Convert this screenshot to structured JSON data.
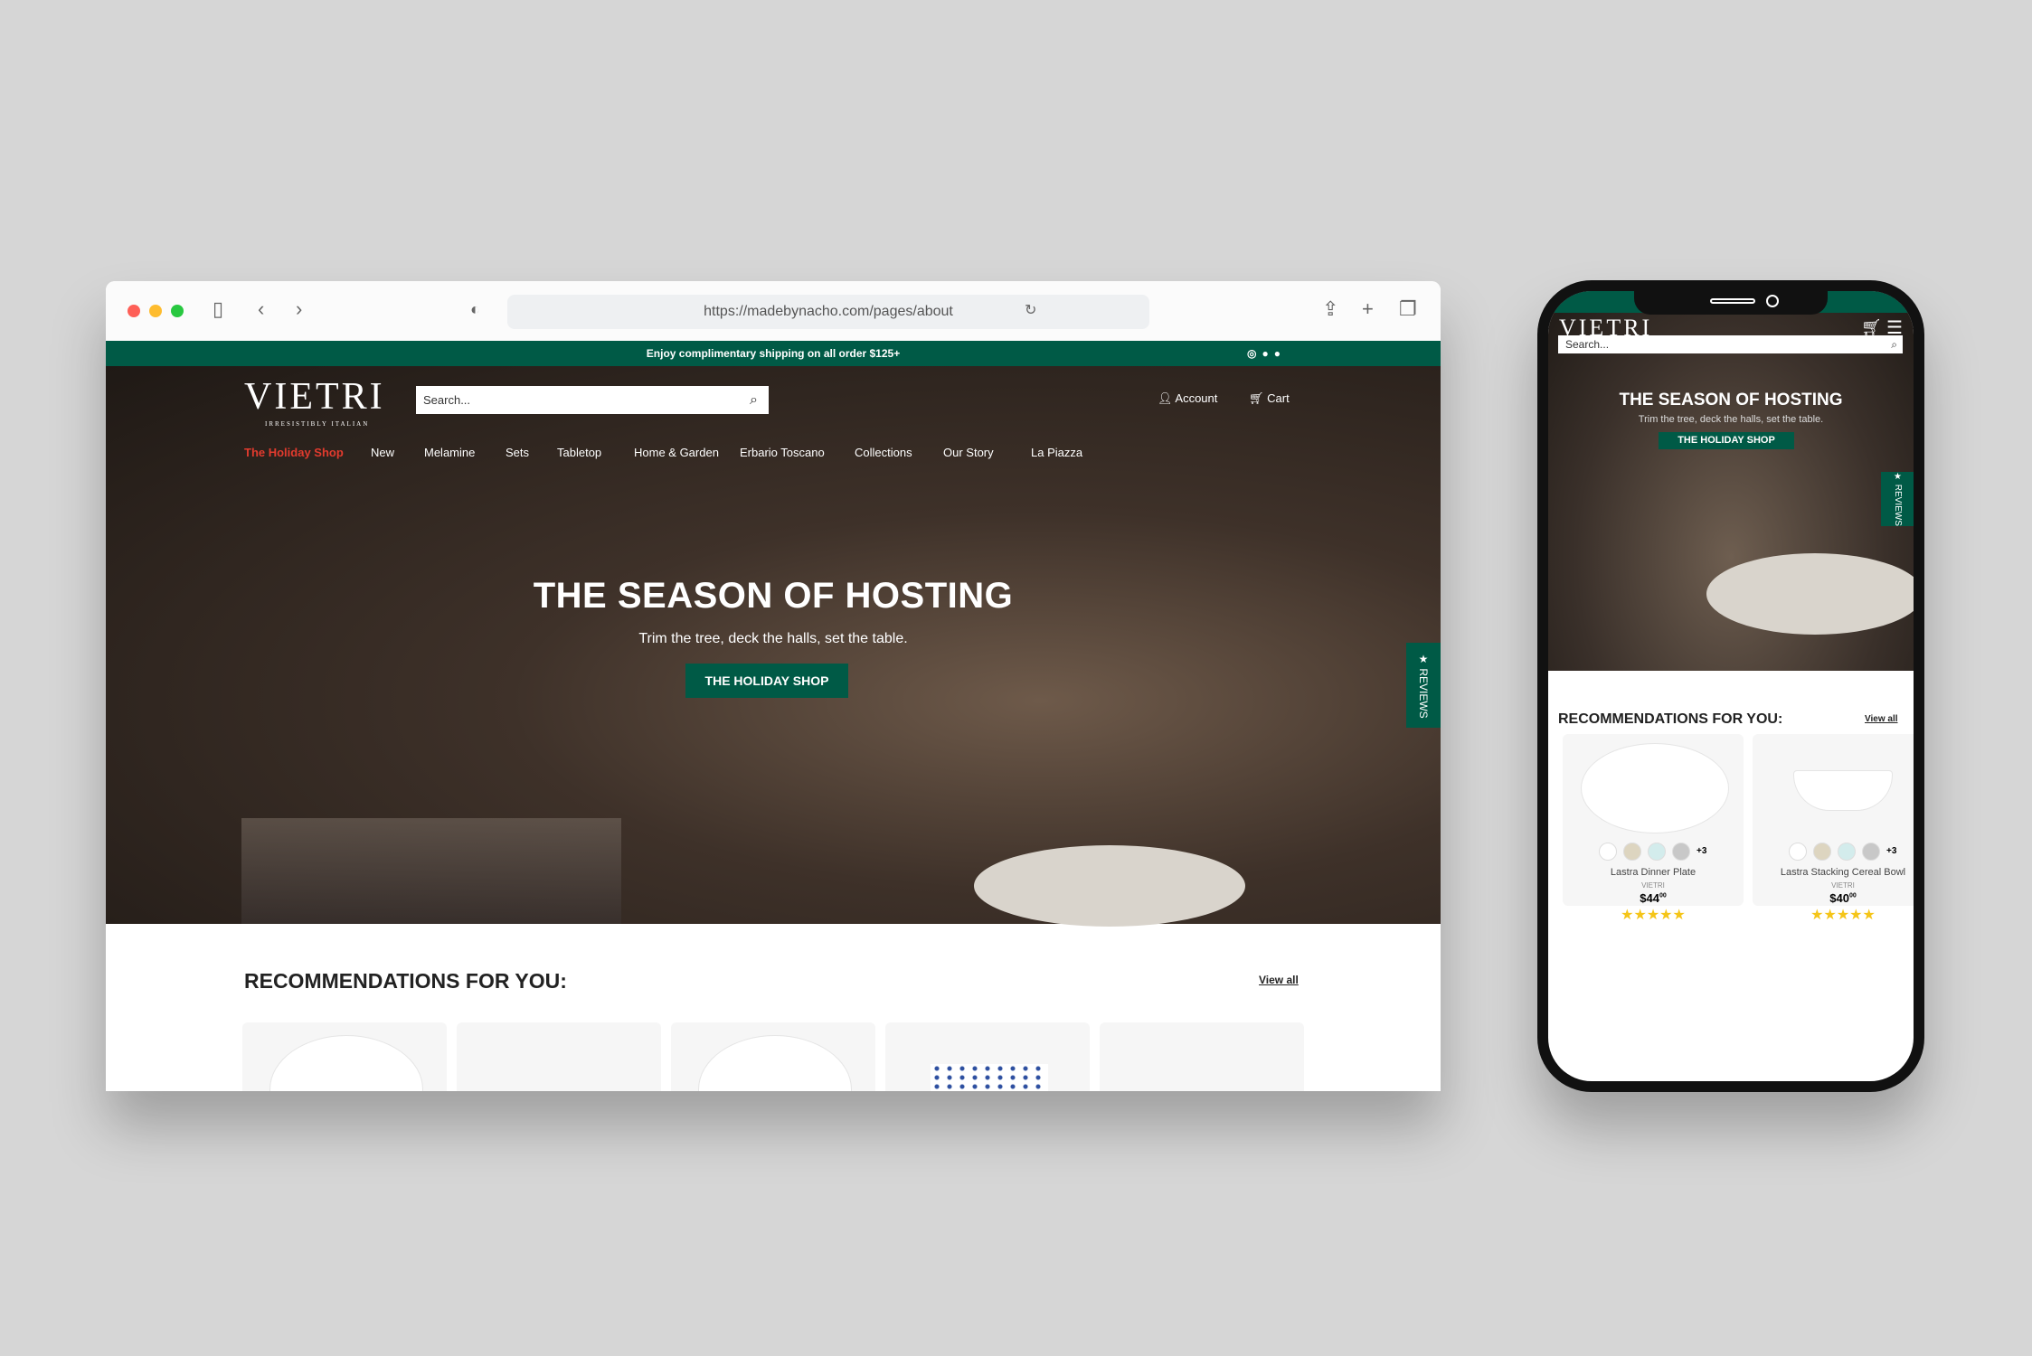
{
  "browser": {
    "url": "https://madebynacho.com/pages/about",
    "colors": {
      "close": "#fe5f57",
      "minimize": "#febc2e",
      "maximize": "#28c840"
    }
  },
  "promo": {
    "text": "Enjoy complimentary shipping on all order $125+",
    "social_icons": [
      "instagram-icon",
      "facebook-icon",
      "pinterest-icon"
    ]
  },
  "header": {
    "logo": "VIETRI",
    "tagline": "IRRESISTIBLY ITALIAN",
    "search_placeholder": "Search...",
    "account": "Account",
    "cart": "Cart"
  },
  "nav": [
    "The Holiday Shop",
    "New",
    "Melamine",
    "Sets",
    "Tabletop",
    "Home & Garden",
    "Erbario Toscano",
    "Collections",
    "Our Story",
    "La Piazza"
  ],
  "hero": {
    "title": "THE SEASON OF HOSTING",
    "subtitle": "Trim the tree, deck the halls, set the table.",
    "cta": "THE HOLIDAY SHOP"
  },
  "reviews_tab": "★ REVIEWS",
  "recommendations": {
    "title": "RECOMMENDATIONS FOR YOU:",
    "view_all": "View all"
  },
  "products": [
    {
      "name": "Lastra Dinner Plate",
      "brand": "VIETRI",
      "price": "$44",
      "cents": "00",
      "more_colors": "+3",
      "rating": 5
    },
    {
      "name": "Lastra Stacking Cereal Bowl",
      "brand": "VIETRI",
      "price": "$40",
      "cents": "00",
      "more_colors": "+3",
      "rating": 5
    }
  ],
  "colors": {
    "brand_green": "#005a46",
    "nav_highlight": "#e23b2e",
    "stars": "#f5c518"
  }
}
